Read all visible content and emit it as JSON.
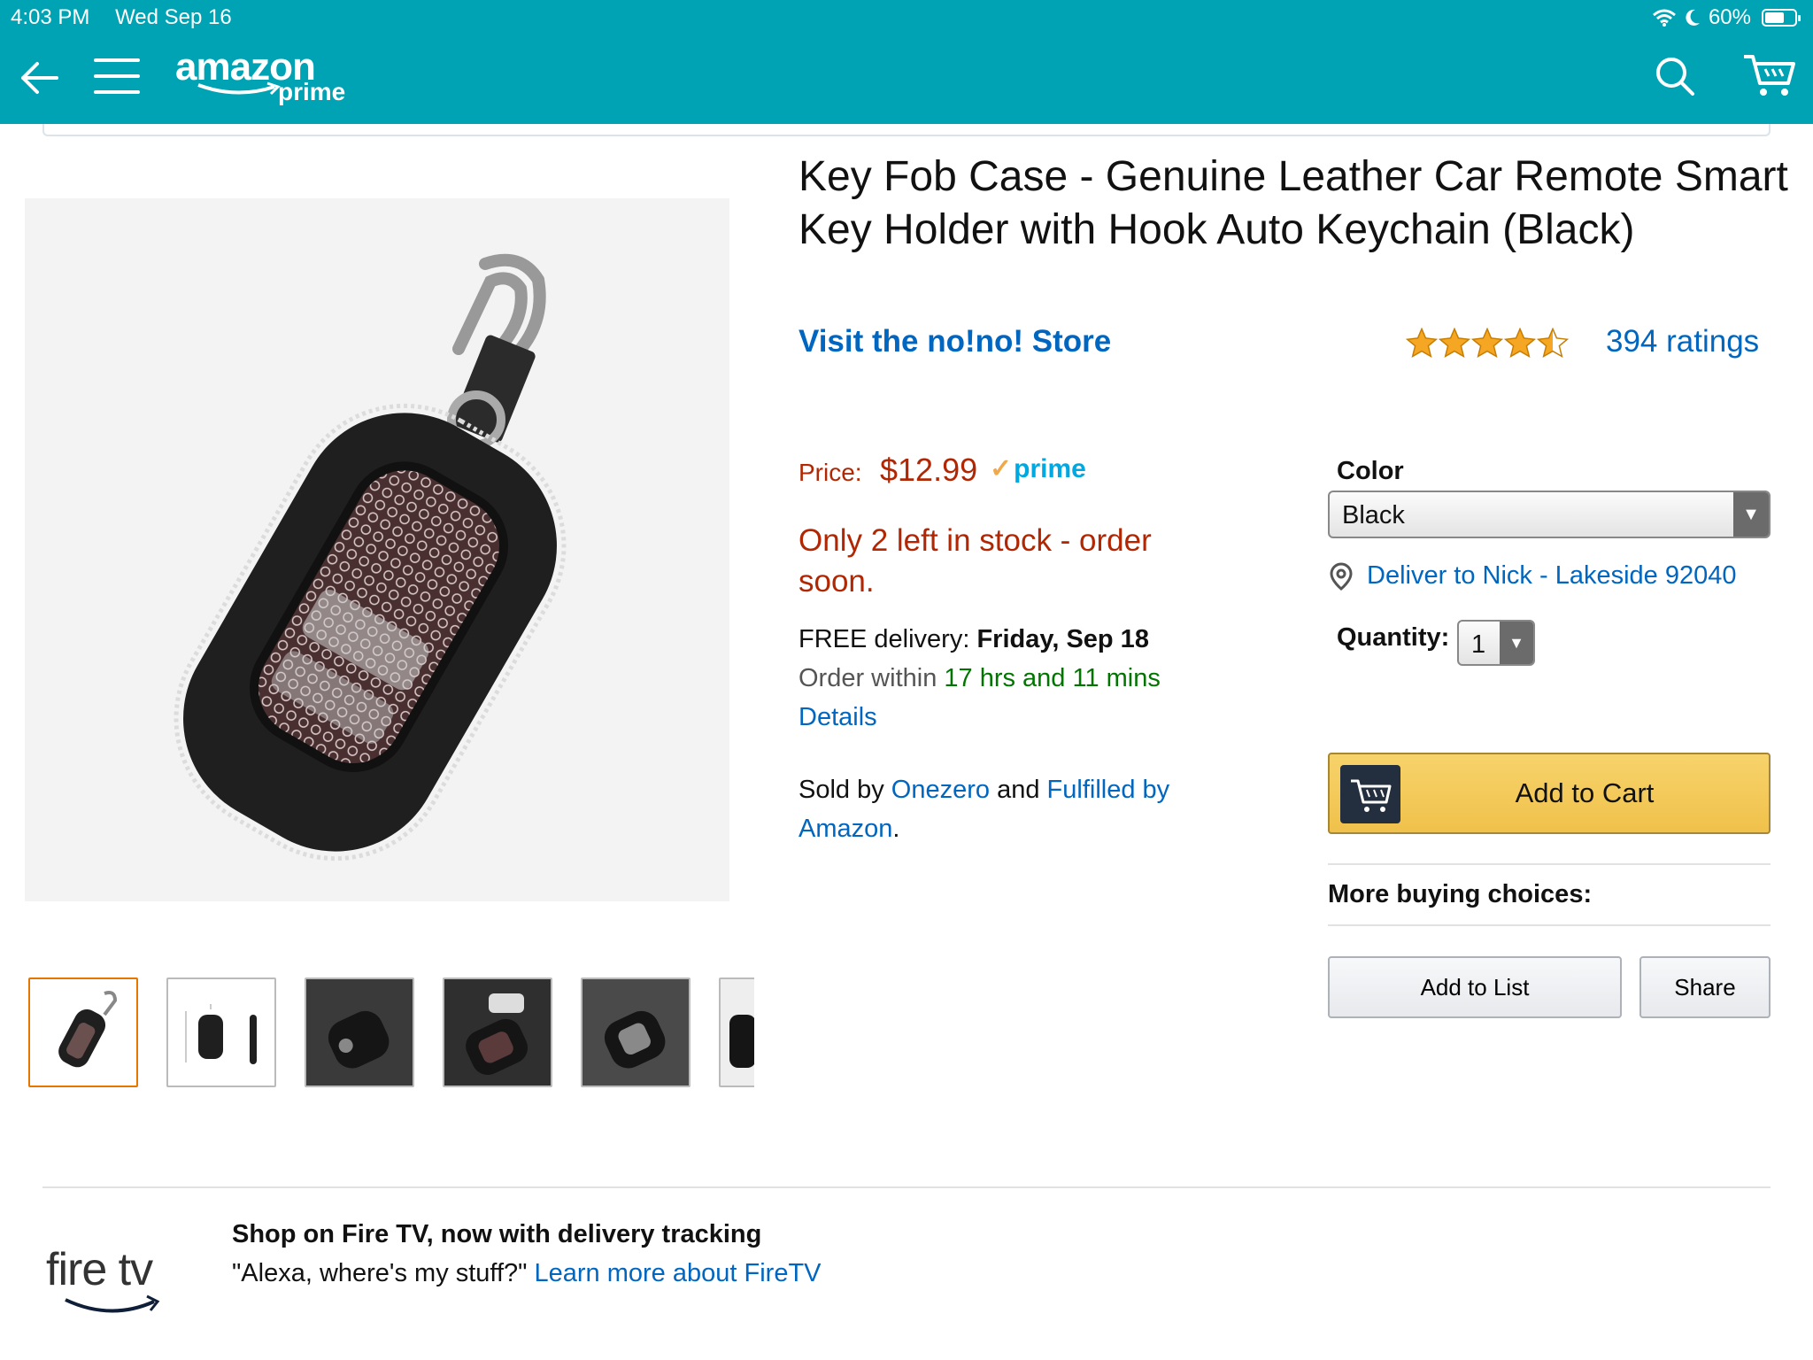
{
  "status_bar": {
    "time": "4:03 PM",
    "date": "Wed Sep 16",
    "battery": "60%",
    "battery_level": 0.6
  },
  "header": {
    "logo_word": "amazon",
    "logo_prime": "prime",
    "bg_color": "#00a3b4",
    "icons": [
      "back-arrow-icon",
      "menu-icon",
      "search-icon",
      "cart-icon"
    ]
  },
  "product": {
    "title": "Key Fob Case - Genuine Leather Car Remote Smart Key Holder with Hook Auto Keychain (Black)",
    "store_link": "Visit the no!no! Store",
    "rating_stars": 4.5,
    "ratings_count": "394 ratings",
    "price_label": "Price:",
    "price": "$12.99",
    "prime": "prime",
    "stock": "Only 2 left in stock - order soon.",
    "delivery_prefix": "FREE delivery: ",
    "delivery_date": "Friday, Sep 18",
    "order_within_prefix": "Order within ",
    "order_within_time": "17 hrs and 11 mins",
    "details_link": "Details",
    "sold_by_prefix": "Sold by ",
    "seller": "Onezero",
    "and": " and ",
    "fulfilled": "Fulfilled by Amazon",
    "period": ".",
    "thumbnail_count": 6,
    "selected_thumbnail": 0
  },
  "buy_box": {
    "color_label": "Color",
    "color_value": "Black",
    "deliver_to": "Deliver to Nick - Lakeside 92040",
    "quantity_label": "Quantity:",
    "quantity_value": "1",
    "add_to_cart": "Add to Cart",
    "more_buying_choices": "More buying choices:",
    "add_to_list": "Add to List",
    "share": "Share",
    "accent_color": "#f0c14b",
    "link_color": "#0066c0",
    "price_color": "#b12704"
  },
  "promo": {
    "logo_word": "fire tv",
    "title": "Shop on Fire TV, now with delivery tracking",
    "text": "\"Alexa, where's my stuff?\" ",
    "link": "Learn more about FireTV"
  }
}
